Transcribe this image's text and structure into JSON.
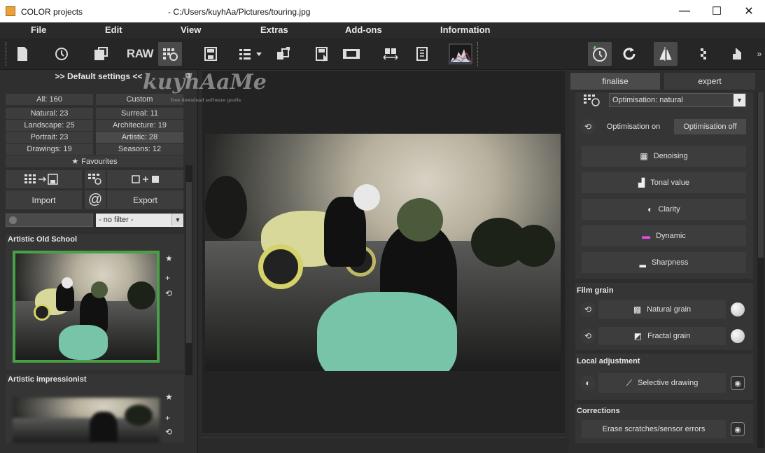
{
  "window": {
    "app_name": "COLOR projects",
    "file_path": "- C:/Users/kuyhAa/Pictures/touring.jpg",
    "minimize_glyph": "—",
    "maximize_glyph": "☐",
    "close_glyph": "✕"
  },
  "menu": {
    "file": "File",
    "edit": "Edit",
    "view": "View",
    "extras": "Extras",
    "addons": "Add-ons",
    "information": "Information"
  },
  "toolbar": {
    "raw_label": "RAW",
    "icons": [
      "new-document-icon",
      "history-icon",
      "save-copy-icon",
      "raw-icon",
      "presets-grid-icon",
      "save-icon",
      "export-menu-icon",
      "batch-icon",
      "save-as-icon",
      "filmstrip-icon",
      "compare-icon",
      "properties-icon",
      "histogram-icon",
      "auto-optimize-icon",
      "redo-icon",
      "split-view-icon",
      "checker-icon",
      "mask-icon",
      "more-icon"
    ]
  },
  "watermark": {
    "text": "kuyhAaMe",
    "sub": "free download software gratis"
  },
  "left_panel": {
    "header": ">> Default settings <<",
    "categories": [
      {
        "label": "All: 160"
      },
      {
        "label": "Custom"
      },
      {
        "label": "Natural: 23"
      },
      {
        "label": "Surreal: 11"
      },
      {
        "label": "Landscape: 25"
      },
      {
        "label": "Architecture: 19"
      },
      {
        "label": "Portrait: 23"
      },
      {
        "label": "Artistic: 28"
      },
      {
        "label": "Drawings: 19"
      },
      {
        "label": "Seasons: 12"
      }
    ],
    "favourites": "Favourites",
    "import": "Import",
    "at": "@",
    "export": "Export",
    "filter_value": "- no filter -",
    "presets": [
      {
        "title": "Artistic Old School"
      },
      {
        "title": "Artistic impressionist"
      }
    ]
  },
  "right_panel": {
    "tabs": {
      "finalise": "finalise",
      "expert": "expert"
    },
    "optimisation_select": "Optimisation: natural",
    "optimisation_on": "Optimisation on",
    "optimisation_off": "Optimisation off",
    "tools": {
      "denoising": "Denoising",
      "tonal_value": "Tonal value",
      "clarity": "Clarity",
      "dynamic": "Dynamic",
      "sharpness": "Sharpness"
    },
    "film_grain": {
      "heading": "Film grain",
      "natural": "Natural grain",
      "fractal": "Fractal grain"
    },
    "local_adjustment": {
      "heading": "Local adjustment",
      "selective": "Selective drawing"
    },
    "corrections": {
      "heading": "Corrections",
      "erase": "Erase scratches/sensor errors"
    }
  },
  "colors": {
    "selection_border": "#48a048",
    "panel_bg": "#2d2d2d",
    "button_bg": "#3d3d3d"
  }
}
